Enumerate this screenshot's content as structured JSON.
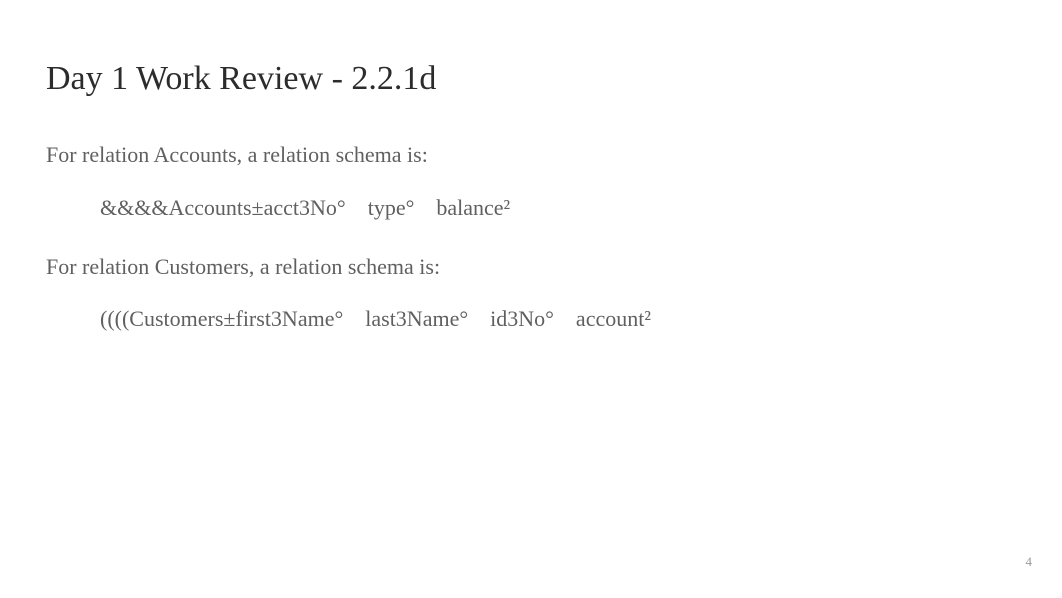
{
  "slide": {
    "title": "Day 1 Work Review - 2.2.1d",
    "line1": "For relation Accounts, a relation schema is:",
    "schema1": "&&&&Accounts±acct3No° type° balance²",
    "line2": "For relation Customers, a relation schema is:",
    "schema2": "((((Customers±first3Name° last3Name° id3No° account²",
    "page_number": "4"
  }
}
